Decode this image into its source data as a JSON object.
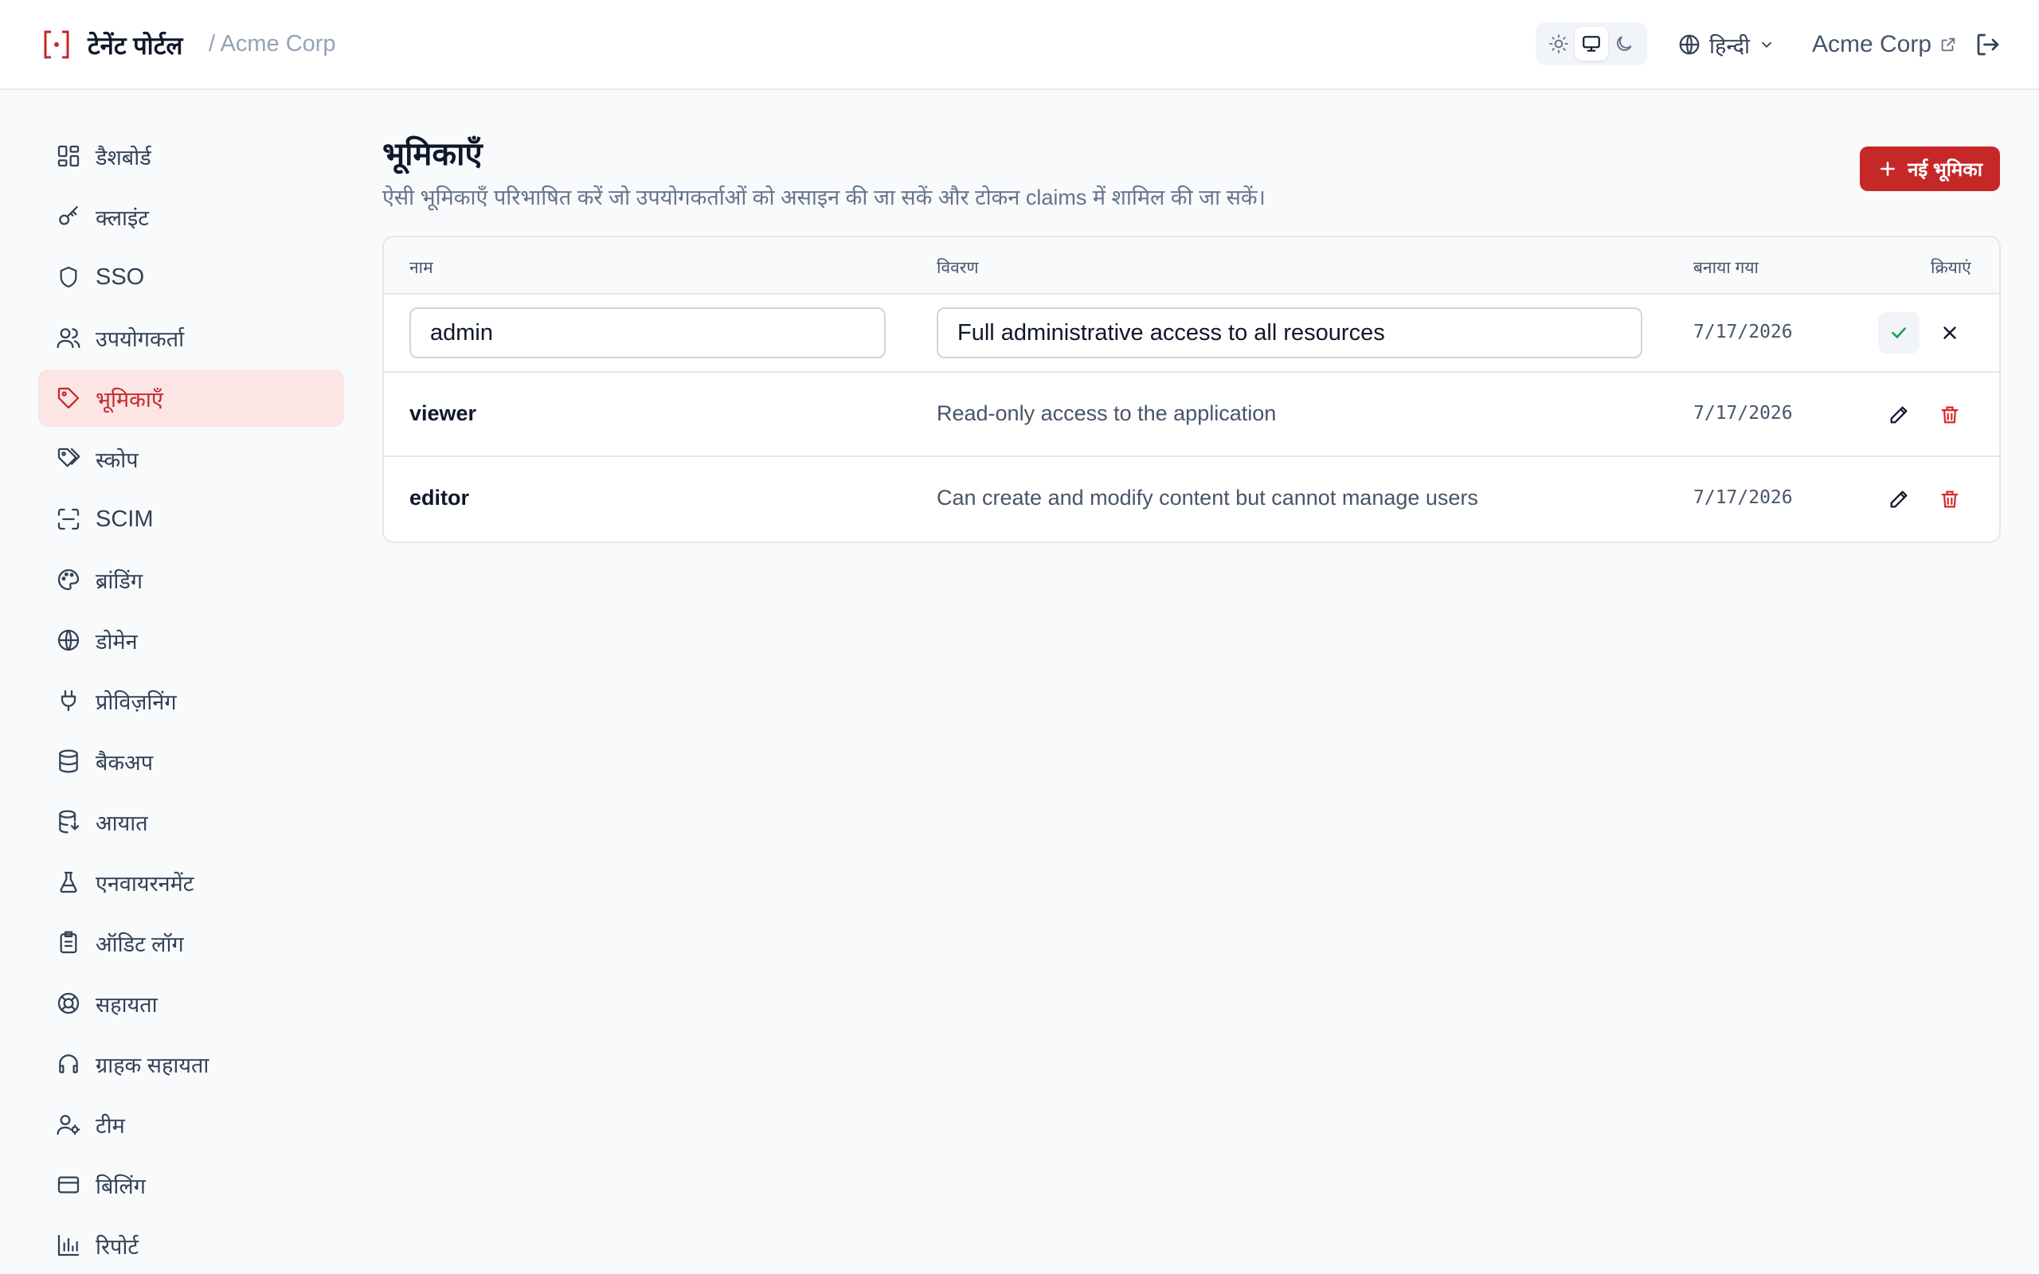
{
  "header": {
    "app_title": "टेनेंट पोर्टल",
    "tenant_crumb": "/ Acme Corp",
    "language": "हिन्दी",
    "tenant_link": "Acme Corp",
    "theme_options": [
      "light",
      "system",
      "dark"
    ],
    "theme_selected": "system"
  },
  "sidebar": {
    "items": [
      {
        "label": "डैशबोर्ड",
        "icon": "dashboard-icon"
      },
      {
        "label": "क्लाइंट",
        "icon": "key-icon"
      },
      {
        "label": "SSO",
        "icon": "shield-icon"
      },
      {
        "label": "उपयोगकर्ता",
        "icon": "users-icon"
      },
      {
        "label": "भूमिकाएँ",
        "icon": "tag-icon",
        "active": true
      },
      {
        "label": "स्कोप",
        "icon": "tags-icon"
      },
      {
        "label": "SCIM",
        "icon": "scan-icon"
      },
      {
        "label": "ब्रांडिंग",
        "icon": "palette-icon"
      },
      {
        "label": "डोमेन",
        "icon": "globe-icon"
      },
      {
        "label": "प्रोविज़निंग",
        "icon": "plug-icon"
      },
      {
        "label": "बैकअप",
        "icon": "database-icon"
      },
      {
        "label": "आयात",
        "icon": "database-import-icon"
      },
      {
        "label": "एनवायरनमेंट",
        "icon": "flask-icon"
      },
      {
        "label": "ऑडिट लॉग",
        "icon": "clipboard-icon"
      },
      {
        "label": "सहायता",
        "icon": "lifebuoy-icon"
      },
      {
        "label": "ग्राहक सहायता",
        "icon": "headset-icon"
      },
      {
        "label": "टीम",
        "icon": "user-cog-icon"
      },
      {
        "label": "बिलिंग",
        "icon": "credit-card-icon"
      },
      {
        "label": "रिपोर्ट",
        "icon": "bar-chart-icon"
      }
    ]
  },
  "main": {
    "title": "भूमिकाएँ",
    "subtitle": "ऐसी भूमिकाएँ परिभाषित करें जो उपयोगकर्ताओं को असाइन की जा सकें और टोकन claims में शामिल की जा सकें।",
    "new_button": "नई भूमिका",
    "table": {
      "headers": {
        "name": "नाम",
        "description": "विवरण",
        "created": "बनाया गया",
        "actions": "क्रियाएं"
      },
      "editing_row": {
        "name": "admin",
        "description": "Full administrative access to all resources",
        "created": "7/17/2026"
      },
      "rows": [
        {
          "name": "viewer",
          "description": "Read-only access to the application",
          "created": "7/17/2026"
        },
        {
          "name": "editor",
          "description": "Can create and modify content but cannot manage users",
          "created": "7/17/2026"
        }
      ]
    }
  },
  "colors": {
    "accent": "#c62828",
    "active_bg": "#fbe5e5",
    "success": "#16a34a"
  }
}
